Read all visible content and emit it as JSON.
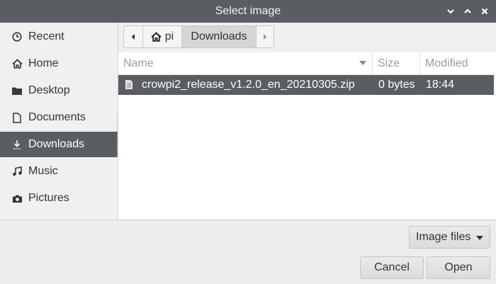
{
  "window": {
    "title": "Select image"
  },
  "sidebar": {
    "items": [
      {
        "label": "Recent",
        "icon": "clock-icon"
      },
      {
        "label": "Home",
        "icon": "home-icon"
      },
      {
        "label": "Desktop",
        "icon": "folder-icon"
      },
      {
        "label": "Documents",
        "icon": "document-icon"
      },
      {
        "label": "Downloads",
        "icon": "download-icon",
        "selected": true
      },
      {
        "label": "Music",
        "icon": "music-icon"
      },
      {
        "label": "Pictures",
        "icon": "camera-icon"
      }
    ]
  },
  "pathbar": {
    "home_label": "pi",
    "current_label": "Downloads"
  },
  "columns": {
    "name": "Name",
    "size": "Size",
    "modified": "Modified"
  },
  "files": [
    {
      "name": "crowpi2_release_v1.2.0_en_20210305.zip",
      "size": "0 bytes",
      "modified": "18:44",
      "selected": true
    }
  ],
  "filter": {
    "label": "Image files"
  },
  "buttons": {
    "cancel": "Cancel",
    "open": "Open"
  },
  "colors": {
    "titlebar": "#5a5e63",
    "selection": "#5a5e63",
    "background": "#ededed"
  }
}
